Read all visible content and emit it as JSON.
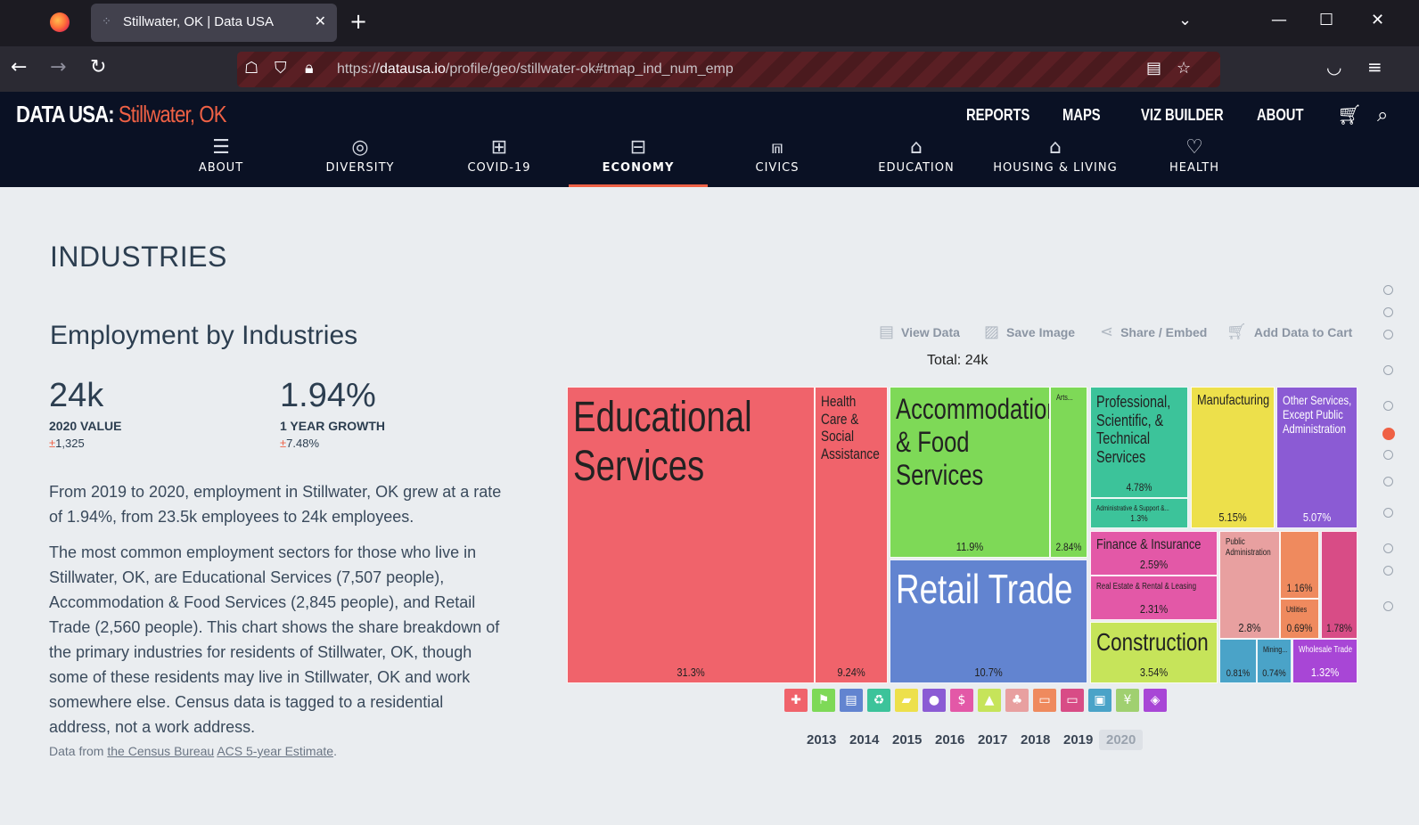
{
  "browser": {
    "tab_title": "Stillwater, OK | Data USA",
    "url_prefix": "https://",
    "url_host": "datausa.io",
    "url_path": "/profile/geo/stillwater-ok#tmap_ind_num_emp"
  },
  "site": {
    "logo": "DATA USA:",
    "place": "Stillwater, OK",
    "top_links": [
      "REPORTS",
      "MAPS",
      "VIZ BUILDER",
      "ABOUT"
    ],
    "sections": [
      {
        "label": "ABOUT",
        "icon": "list-icon"
      },
      {
        "label": "DIVERSITY",
        "icon": "globe-icon"
      },
      {
        "label": "COVID-19",
        "icon": "hospital-icon"
      },
      {
        "label": "ECONOMY",
        "icon": "briefcase-icon",
        "active": true
      },
      {
        "label": "CIVICS",
        "icon": "capitol-icon"
      },
      {
        "label": "EDUCATION",
        "icon": "graduation-cap-icon"
      },
      {
        "label": "HOUSING & LIVING",
        "icon": "house-icon"
      },
      {
        "label": "HEALTH",
        "icon": "heart-icon"
      }
    ]
  },
  "content": {
    "section_title": "INDUSTRIES",
    "sub_title": "Employment by Industries",
    "stats": [
      {
        "value": "24k",
        "label": "2020 VALUE",
        "moe": "1,325"
      },
      {
        "value": "1.94%",
        "label": "1 YEAR GROWTH",
        "moe": "7.48%"
      }
    ],
    "paragraph1": "From 2019 to 2020, employment in Stillwater, OK grew at a rate of 1.94%, from 23.5k employees to 24k employees.",
    "paragraph2": "The most common employment sectors for those who live in Stillwater, OK, are Educational Services (7,507 people), Accommodation & Food Services (2,845 people), and Retail Trade (2,560 people). This chart shows the share breakdown of the primary industries for residents of Stillwater, OK, though some of these residents may live in Stillwater, OK and work somewhere else. Census data is tagged to a residential address, not a work address.",
    "source_prefix": "Data from ",
    "source_link1": "the Census Bureau",
    "source_link2": "ACS 5-year Estimate",
    "source_suffix": "."
  },
  "viz": {
    "options": [
      "View Data",
      "Save Image",
      "Share / Embed",
      "Add Data to Cart"
    ],
    "total": "Total: 24k",
    "years": [
      "2013",
      "2014",
      "2015",
      "2016",
      "2017",
      "2018",
      "2019",
      "2020"
    ],
    "active_year": "2020"
  },
  "chart_data": {
    "type": "treemap",
    "total": "24k",
    "items": [
      {
        "name": "Educational Services",
        "pct": "31.3%",
        "value": 31.3,
        "color": "#f0636b"
      },
      {
        "name": "Health Care & Social Assistance",
        "pct": "9.24%",
        "value": 9.24,
        "color": "#f0636b"
      },
      {
        "name": "Accommodation & Food Services",
        "pct": "11.9%",
        "value": 11.9,
        "color": "#7ed957"
      },
      {
        "name": "Arts...",
        "pct": "2.84%",
        "value": 2.84,
        "color": "#7ed957"
      },
      {
        "name": "Retail Trade",
        "pct": "10.7%",
        "value": 10.7,
        "color": "#6284d0"
      },
      {
        "name": "Professional, Scientific, & Technical Services",
        "pct": "4.78%",
        "value": 4.78,
        "color": "#3cc39a"
      },
      {
        "name": "Administrative & Support &...",
        "pct": "1.3%",
        "value": 1.3,
        "color": "#3cc39a"
      },
      {
        "name": "Manufacturing",
        "pct": "5.15%",
        "value": 5.15,
        "color": "#ede04b"
      },
      {
        "name": "Other Services, Except Public Administration",
        "pct": "5.07%",
        "value": 5.07,
        "color": "#8b5bd4"
      },
      {
        "name": "Finance & Insurance",
        "pct": "2.59%",
        "value": 2.59,
        "color": "#e358a7"
      },
      {
        "name": "Real Estate & Rental & Leasing",
        "pct": "2.31%",
        "value": 2.31,
        "color": "#e358a7"
      },
      {
        "name": "Construction",
        "pct": "3.54%",
        "value": 3.54,
        "color": "#c6e45a"
      },
      {
        "name": "Public Administration",
        "pct": "2.8%",
        "value": 2.8,
        "color": "#e8a0a0"
      },
      {
        "name": "",
        "pct": "1.16%",
        "value": 1.16,
        "color": "#ef8a5e"
      },
      {
        "name": "Utilities",
        "pct": "0.69%",
        "value": 0.69,
        "color": "#ef8a5e"
      },
      {
        "name": "",
        "pct": "1.78%",
        "value": 1.78,
        "color": "#d84c86"
      },
      {
        "name": "",
        "pct": "0.81%",
        "value": 0.81,
        "color": "#4aa3c8"
      },
      {
        "name": "Mining...",
        "pct": "0.74%",
        "value": 0.74,
        "color": "#4aa3c8"
      },
      {
        "name": "Wholesale Trade",
        "pct": "1.32%",
        "value": 1.32,
        "color": "#a846d6"
      }
    ],
    "legend_colors": [
      "#f0636b",
      "#7ed957",
      "#6284d0",
      "#3cc39a",
      "#ede04b",
      "#8b5bd4",
      "#e358a7",
      "#c6e45a",
      "#e8a0a0",
      "#ef8a5e",
      "#d84c86",
      "#4aa3c8",
      "#a0d070",
      "#a846d6"
    ]
  }
}
